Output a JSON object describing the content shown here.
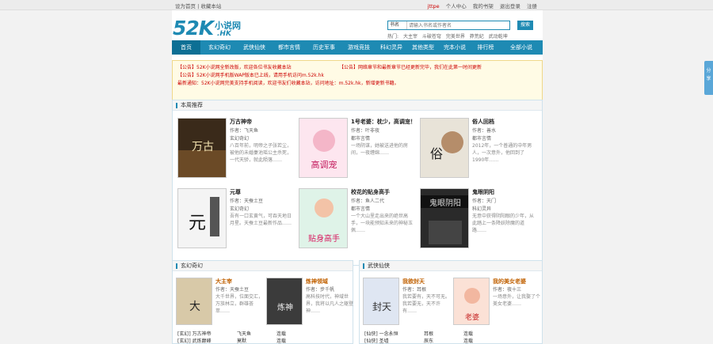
{
  "topbar": {
    "left_text": "设为首页 | 收藏本站",
    "right_items": [
      "jttpe",
      "个人中心",
      "我的书架",
      "退出登录",
      "注册"
    ]
  },
  "logo": {
    "mark": "52K",
    "cn": "小说网",
    "hk": ".HK"
  },
  "search": {
    "select": "书名",
    "placeholder": "请输入书名或作者名",
    "button": "搜索"
  },
  "hot": [
    "热门:",
    "大主宰",
    "斗破苍穹",
    "完美世界",
    "莽荒纪",
    "武动乾坤"
  ],
  "nav": {
    "items": [
      "首页",
      "玄幻奇幻",
      "武侠仙侠",
      "都市言情",
      "历史军事",
      "游戏竞技",
      "科幻灵异",
      "其他类型",
      "完本小说",
      "排行榜",
      "全部小说"
    ]
  },
  "notice": {
    "rows": [
      {
        "tag": "【公告】",
        "text": "52K小说网全新改版，欢迎各位书友收藏本站",
        "tag2": "【公告】",
        "text2": "网络章节和最新章节已经更新完毕，我们在此第一时间更新"
      },
      {
        "tag": "【公告】",
        "text": "52K小说网手机版WAP版本已上线，请用手机访问m.52k.hk"
      },
      {
        "tag": "最新通知：",
        "text": "52K小说网完美支持手机阅读，欢迎书友们收藏本站，访问地址：m.52k.hk，新增更新书籍。"
      }
    ]
  },
  "weekly": {
    "title": "本周推荐",
    "books": [
      {
        "title": "万古神帝",
        "author": "作者：飞天鱼",
        "cat": "玄幻奇幻",
        "desc": "八百年前，明帝之子张若尘，被他的未婚妻池瑶公主杀死，一代天骄，就此陨落……"
      },
      {
        "title": "1号老婆：枕少，高调宠！",
        "author": "作者：叶非夜",
        "cat": "都市言情",
        "desc": "一场阴谋，她被送进他的房间，一夜缠绵……"
      },
      {
        "title": "俗人回档",
        "author": "作者：善水",
        "cat": "都市言情",
        "desc": "2012年，一个普通的中年男人，一次意外，他回到了1990年……"
      },
      {
        "title": "元尊",
        "author": "作者：天蚕土豆",
        "cat": "玄幻奇幻",
        "desc": "吾有一口玄黄气，可吞天地日月星。天蚕土豆最新作品……"
      },
      {
        "title": "校花的贴身高手",
        "author": "作者：鱼人二代",
        "cat": "都市言情",
        "desc": "一个大山里走出来的绝世高手，一块能预知未来的神秘玉佩……"
      },
      {
        "title": "鬼眼阴阳",
        "author": "作者：天门",
        "cat": "科幻灵异",
        "desc": "无意中获得阴阳眼的少年，从此踏上一条降妖除魔的道路……"
      }
    ]
  },
  "xuanhuan": {
    "title": "玄幻奇幻",
    "books": [
      {
        "title": "大主宰",
        "author": "作者：天蚕土豆",
        "desc": "大千世界，位面交汇，万族林立，群雄荟萃……"
      },
      {
        "title": "炼神领域",
        "author": "作者：步千帆",
        "desc": "高科技时代，神域世界，我将以凡人之躯登神……"
      }
    ],
    "list": [
      {
        "a": "[玄幻] 万古神帝",
        "b": "飞天鱼",
        "c": "连载"
      },
      {
        "a": "[玄幻] 武炼巅峰",
        "b": "莫默",
        "c": "连载"
      }
    ]
  },
  "wuxia": {
    "title": "武侠仙侠",
    "books": [
      {
        "title": "我欲封天",
        "author": "作者：耳根",
        "desc": "我若要有，天不可无。我若要无，天不许有……"
      },
      {
        "title": "我的美女老婆",
        "author": "作者：夜十三",
        "desc": "一场意外，让我娶了个美女老婆……"
      }
    ],
    "list": [
      {
        "a": "[仙侠] 一念永恒",
        "b": "耳根",
        "c": "连载"
      },
      {
        "a": "[仙侠] 圣墟",
        "b": "辰东",
        "c": "连载"
      }
    ]
  },
  "share": {
    "chars": [
      "分",
      "享"
    ]
  },
  "colors": {
    "brand": "#1e8ab3",
    "notice_red": "#cc0000"
  }
}
